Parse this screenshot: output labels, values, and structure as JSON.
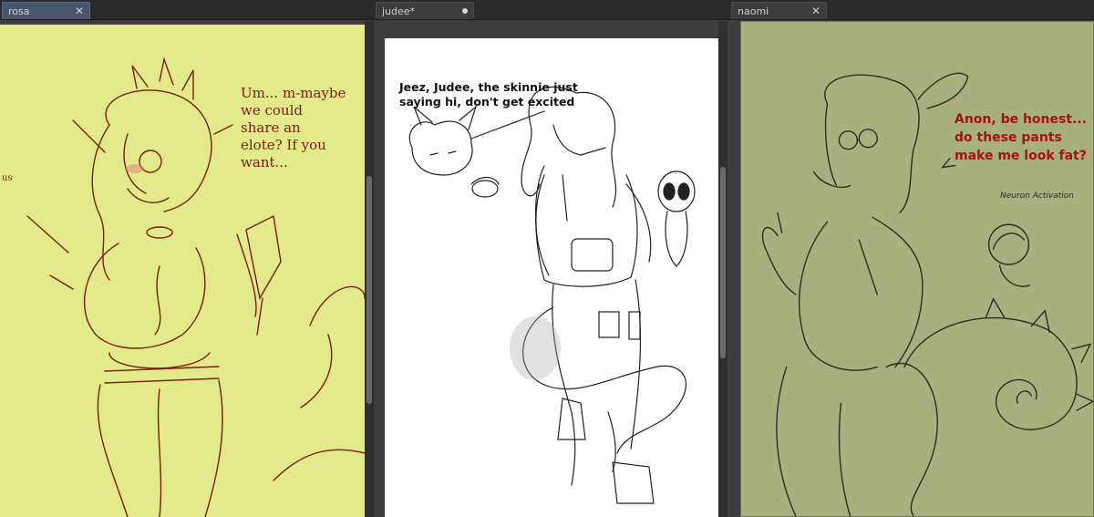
{
  "tabs": [
    {
      "label": "rosa",
      "close_glyph": "✕",
      "active": true
    },
    {
      "label": "judee*",
      "modified_dot": true,
      "active": false
    },
    {
      "label": "naomi",
      "close_glyph": "✕",
      "active": false
    }
  ],
  "panes": {
    "rosa": {
      "speech": "Um... m-maybe\nwe could\nshare an\nelote? If you\nwant...",
      "side_text": "us",
      "canvas_color": "#e2ea8a",
      "line_color": "#7a1c12"
    },
    "judee": {
      "speech": "Jeez, Judee, the skinnie just saying hi, don't get excited",
      "canvas_color": "#ffffff",
      "line_color": "#222222"
    },
    "naomi": {
      "speech": "Anon, be honest...\ndo these pants\nmake me look fat?",
      "note": "Neuron Activation",
      "canvas_color": "#a7b07e",
      "line_color": "#2b2b22",
      "speech_color": "#a01414"
    }
  },
  "icons": {
    "close": "close-icon",
    "modified": "unsaved-dot-icon"
  }
}
